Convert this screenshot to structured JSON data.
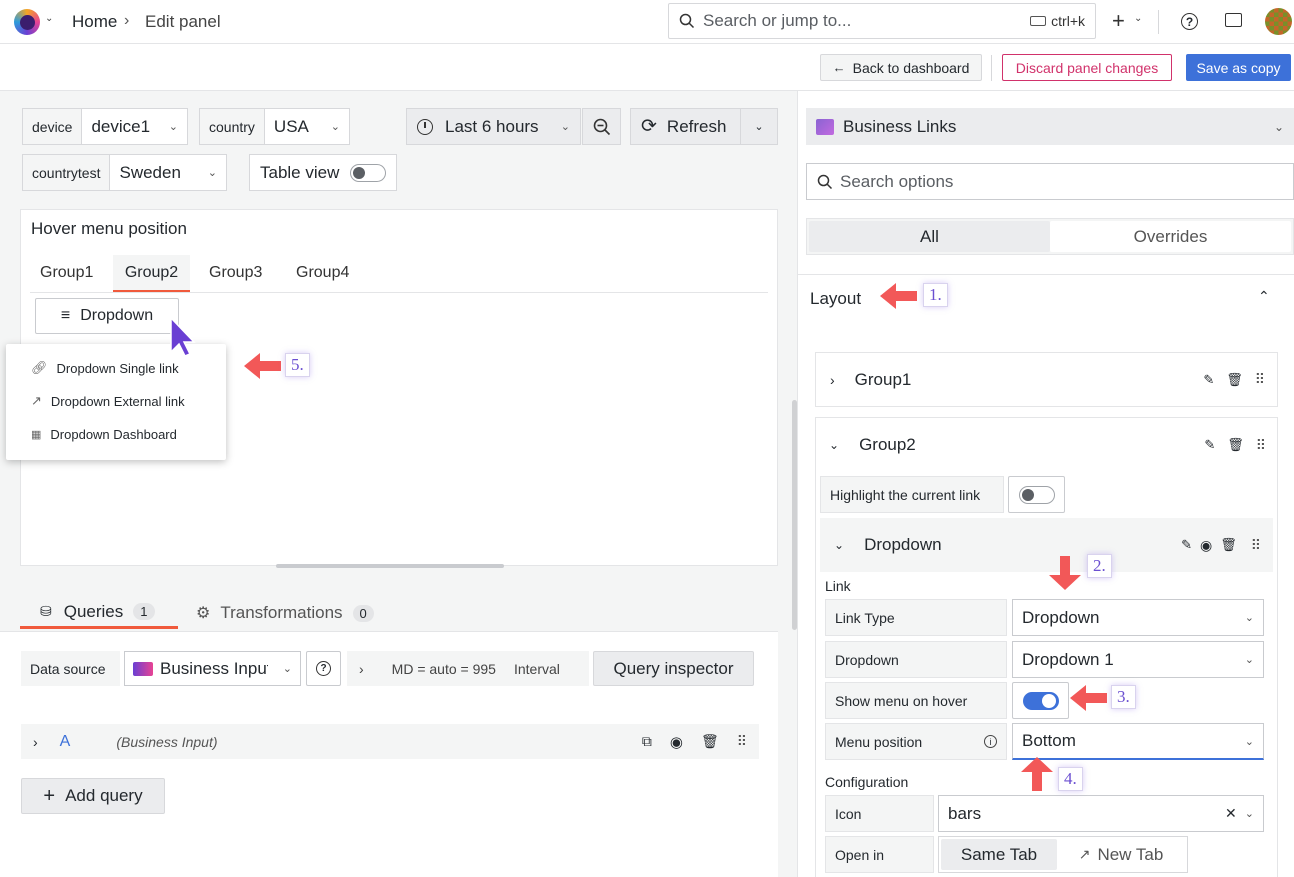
{
  "topbar": {
    "breadcrumb_home": "Home",
    "breadcrumb_sep": "›",
    "breadcrumb_current": "Edit panel",
    "search_placeholder": "Search or jump to...",
    "search_shortcut": "ctrl+k"
  },
  "actions": {
    "back": "Back to dashboard",
    "discard": "Discard panel changes",
    "save_copy": "Save as copy"
  },
  "variables": [
    {
      "label": "device",
      "value": "device1"
    },
    {
      "label": "country",
      "value": "USA"
    },
    {
      "label": "countrytest",
      "value": "Sweden"
    }
  ],
  "table_view": "Table view",
  "time_range": "Last 6 hours",
  "refresh": "Refresh",
  "panel": {
    "title": "Hover menu position",
    "tabs": [
      "Group1",
      "Group2",
      "Group3",
      "Group4"
    ],
    "active_tab": "Group2",
    "dropdown_button": "Dropdown",
    "menu_items": [
      "Dropdown Single link",
      "Dropdown External link",
      "Dropdown Dashboard"
    ]
  },
  "query_tabs": {
    "queries": "Queries",
    "queries_count": "1",
    "transformations": "Transformations",
    "transformations_count": "0"
  },
  "datasource": {
    "label": "Data source",
    "value": "Business Input",
    "md": "MD = auto = 995",
    "interval": "Interval",
    "inspector": "Query inspector"
  },
  "query_row": {
    "ref": "A",
    "name": "(Business Input)"
  },
  "add_query": "Add query",
  "options": {
    "viz_name": "Business Links",
    "search_placeholder": "Search options",
    "tab_all": "All",
    "tab_overrides": "Overrides",
    "section_layout": "Layout",
    "group1": "Group1",
    "group2": "Group2",
    "highlight_label": "Highlight the current link",
    "dropdown_item": "Dropdown",
    "link_header": "Link",
    "link_type_label": "Link Type",
    "link_type_value": "Dropdown",
    "dropdown_label": "Dropdown",
    "dropdown_value": "Dropdown 1",
    "show_hover_label": "Show menu on hover",
    "menu_position_label": "Menu position",
    "menu_position_value": "Bottom",
    "config_header": "Configuration",
    "icon_label": "Icon",
    "icon_value": "bars",
    "open_in_label": "Open in",
    "open_same": "Same Tab",
    "open_new": "New Tab"
  },
  "annotations": [
    "1.",
    "2.",
    "3.",
    "4.",
    "5."
  ],
  "colors": {
    "primary": "#3d71d9",
    "destructive": "#d1326b",
    "annotation_arrow": "#f25858",
    "annotation_text": "#6b4fd1",
    "cursor": "#6a3fd3"
  }
}
